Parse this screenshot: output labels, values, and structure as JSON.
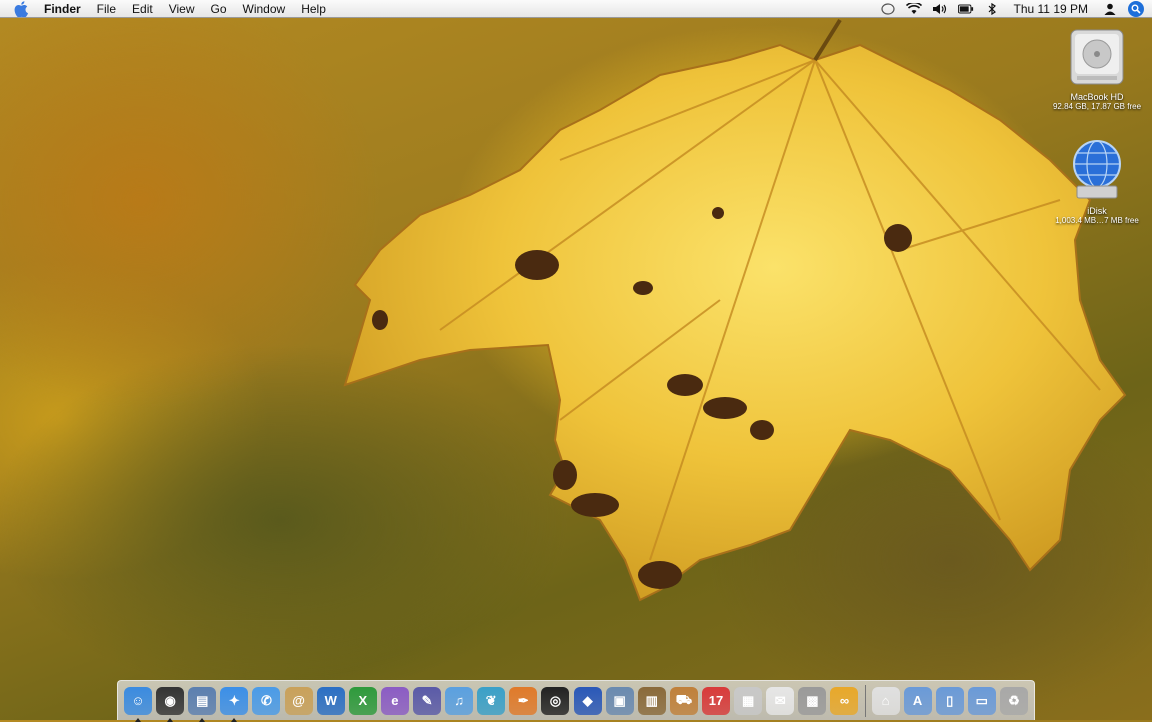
{
  "menubar": {
    "apple_icon": "apple-icon",
    "app_name": "Finder",
    "menus": [
      "File",
      "Edit",
      "View",
      "Go",
      "Window",
      "Help"
    ],
    "status_icons": [
      "sync-icon",
      "wifi-icon",
      "volume-icon",
      "battery-icon",
      "bluetooth-icon"
    ],
    "clock": "Thu 11 19 PM",
    "user_icon": "user-icon",
    "spotlight_icon": "spotlight-search-icon"
  },
  "desktop": {
    "icons": [
      {
        "name": "MacBook HD",
        "sub": "92.84 GB, 17.87 GB free",
        "icon": "hard-drive-icon"
      },
      {
        "name": "iDisk",
        "sub": "1,003.4 MB…7 MB free",
        "icon": "idisk-icon"
      }
    ]
  },
  "dock": {
    "apps": [
      {
        "icon": "finder-icon",
        "running": true,
        "color": "#3a8be0",
        "glyph": "☺"
      },
      {
        "icon": "dashboard-icon",
        "running": true,
        "color": "#333333",
        "glyph": "◉"
      },
      {
        "icon": "preview-icon",
        "running": true,
        "color": "#5b7fb0",
        "glyph": "▤"
      },
      {
        "icon": "safari-icon",
        "running": true,
        "color": "#3b8fe8",
        "glyph": "✦"
      },
      {
        "icon": "ichat-icon",
        "running": false,
        "color": "#4a9be8",
        "glyph": "✆"
      },
      {
        "icon": "address-book-icon",
        "running": false,
        "color": "#c9a15a",
        "glyph": "@"
      },
      {
        "icon": "word-icon",
        "running": false,
        "color": "#2b6fc4",
        "glyph": "W"
      },
      {
        "icon": "excel-icon",
        "running": false,
        "color": "#2e9a3c",
        "glyph": "X"
      },
      {
        "icon": "entourage-icon",
        "running": false,
        "color": "#8b5cc4",
        "glyph": "e"
      },
      {
        "icon": "pencil-app-icon",
        "running": false,
        "color": "#5a5aa8",
        "glyph": "✎"
      },
      {
        "icon": "itunes-icon",
        "running": false,
        "color": "#5aa0e0",
        "glyph": "♫"
      },
      {
        "icon": "feather-app-icon",
        "running": false,
        "color": "#3aa0c8",
        "glyph": "❦"
      },
      {
        "icon": "pages-icon",
        "running": false,
        "color": "#e07a2a",
        "glyph": "✒"
      },
      {
        "icon": "aperture-icon",
        "running": false,
        "color": "#222222",
        "glyph": "◎"
      },
      {
        "icon": "keynote-icon",
        "running": false,
        "color": "#2a58b8",
        "glyph": "◆"
      },
      {
        "icon": "iphoto-icon",
        "running": false,
        "color": "#6a8ab0",
        "glyph": "▣"
      },
      {
        "icon": "photo-booth-icon",
        "running": false,
        "color": "#8a6a3a",
        "glyph": "▥"
      },
      {
        "icon": "delivery-icon",
        "running": false,
        "color": "#c0803a",
        "glyph": "⛟"
      },
      {
        "icon": "ical-icon",
        "running": false,
        "color": "#d83a3a",
        "glyph": "17"
      },
      {
        "icon": "package-icon",
        "running": false,
        "color": "#c8c8c8",
        "glyph": "▦"
      },
      {
        "icon": "textedit-icon",
        "running": false,
        "color": "#e6e6e6",
        "glyph": "✉"
      },
      {
        "icon": "calculator-icon",
        "running": false,
        "color": "#9a9a9a",
        "glyph": "▩"
      },
      {
        "icon": "infinity-app-icon",
        "running": false,
        "color": "#e8a82a",
        "glyph": "∞"
      }
    ],
    "folders": [
      {
        "icon": "home-folder-icon",
        "color": "#e0e0e0",
        "glyph": "⌂"
      },
      {
        "icon": "applications-folder-icon",
        "color": "#6a9ad8",
        "glyph": "A"
      },
      {
        "icon": "documents-folder-icon",
        "color": "#6a9ad8",
        "glyph": "▯"
      },
      {
        "icon": "downloads-folder-icon",
        "color": "#6a9ad8",
        "glyph": "▭"
      },
      {
        "icon": "trash-icon",
        "color": "#a8a8a8",
        "glyph": "♻"
      }
    ]
  }
}
